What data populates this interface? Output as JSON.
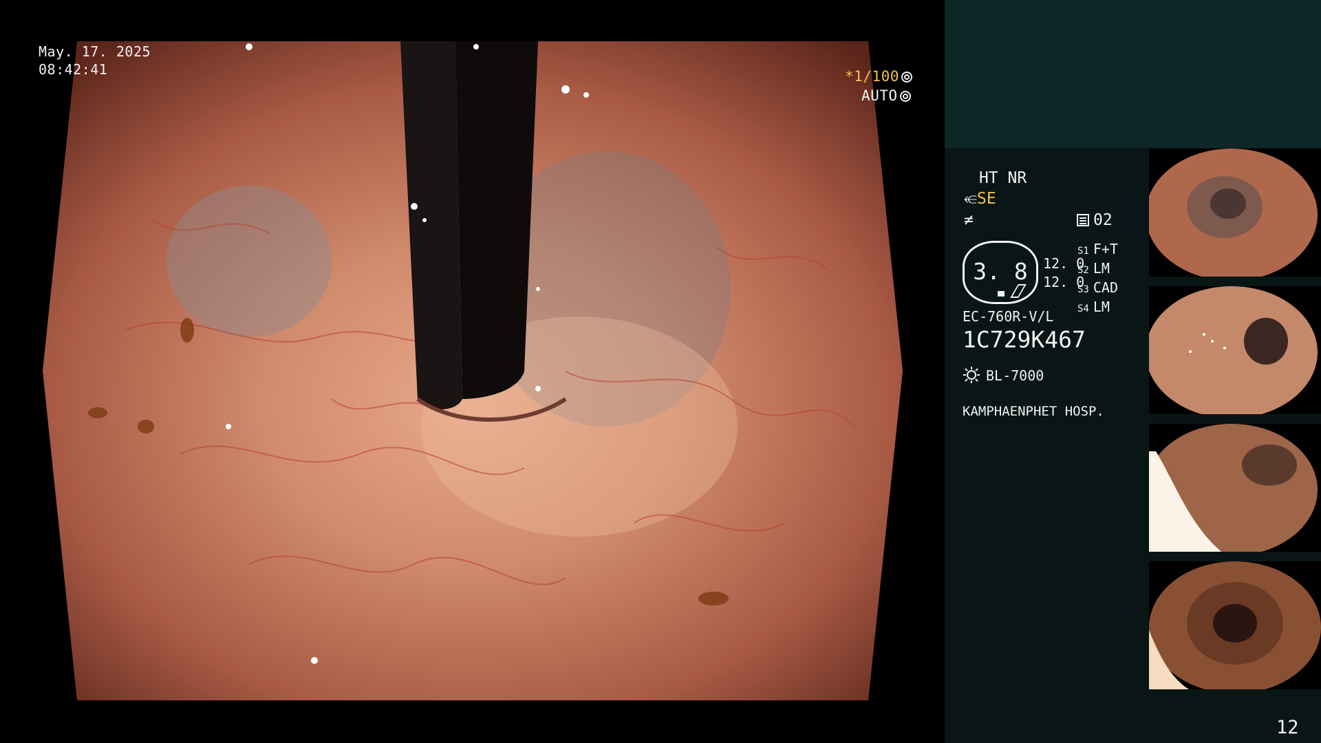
{
  "overlay": {
    "date": "May. 17. 2025",
    "time": "08:42:41",
    "shutter": "*1/100",
    "mode": "AUTO"
  },
  "info_panel": {
    "ht_nr": "HT NR",
    "enhance_label": "SE",
    "slot_number": "02",
    "zoom": "3. 8",
    "readings": [
      "12. 0",
      "12. 0"
    ],
    "stations": [
      {
        "key": "S1",
        "value": "F+T"
      },
      {
        "key": "S2",
        "value": "LM"
      },
      {
        "key": "S3",
        "value": "CAD"
      },
      {
        "key": "S4",
        "value": "LM"
      }
    ],
    "scope_model": "EC-760R-V/L",
    "serial": "1C729K467",
    "light_source": "BL-7000",
    "hospital": "KAMPHAENPHET HOSP."
  },
  "frame_count": "12",
  "icons": {
    "shutter_icon": "aperture-icon",
    "mode_icon": "target-icon",
    "enhance_icon": "structure-enhance-icon",
    "color_icon": "color-mode-icon",
    "slot_icon": "memory-slot-icon",
    "light_icon": "sun-icon"
  },
  "colors": {
    "highlight": "#f4c04b",
    "panel": "#0a1616",
    "panel_header": "#0e2828"
  }
}
